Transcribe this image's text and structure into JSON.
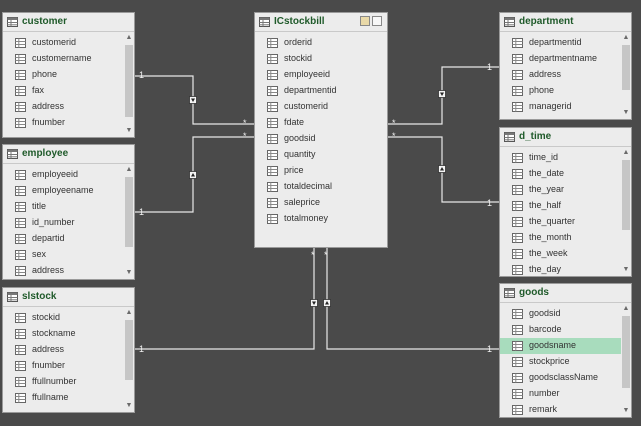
{
  "tables": [
    {
      "title": "customer",
      "fields": [
        "customerid",
        "customername",
        "phone",
        "fax",
        "address",
        "fnumber"
      ],
      "has_scroll": true
    },
    {
      "title": "employee",
      "fields": [
        "employeeid",
        "employeename",
        "title",
        "id_number",
        "departid",
        "sex",
        "address"
      ],
      "has_scroll": true
    },
    {
      "title": "slstock",
      "fields": [
        "stockid",
        "stockname",
        "address",
        "fnumber",
        "ffullnumber",
        "ffullname"
      ],
      "has_scroll": true
    },
    {
      "title": "ICstockbill",
      "fields": [
        "orderid",
        "stockid",
        "employeeid",
        "departmentid",
        "customerid",
        "fdate",
        "goodsid",
        "quantity",
        "price",
        "totaldecimal",
        "saleprice",
        "totalmoney"
      ],
      "has_scroll": false,
      "header_buttons": true
    },
    {
      "title": "department",
      "fields": [
        "departmentid",
        "departmentname",
        "address",
        "phone",
        "managerid"
      ],
      "has_scroll": true
    },
    {
      "title": "d_time",
      "fields": [
        "time_id",
        "the_date",
        "the_year",
        "the_half",
        "the_quarter",
        "the_month",
        "the_week",
        "the_day"
      ],
      "has_scroll": true
    },
    {
      "title": "goods",
      "fields": [
        "goodsid",
        "barcode",
        "goodsname",
        "stockprice",
        "goodsclassName",
        "number",
        "remark"
      ],
      "has_scroll": true,
      "selected_field": "goodsname"
    }
  ],
  "relationships": [
    {
      "one": "customer",
      "many": "ICstockbill",
      "one_label": "1",
      "many_label": "*"
    },
    {
      "one": "employee",
      "many": "ICstockbill",
      "one_label": "1",
      "many_label": "*"
    },
    {
      "one": "slstock",
      "many": "ICstockbill",
      "one_label": "1",
      "many_label": "*"
    },
    {
      "one": "department",
      "many": "ICstockbill",
      "one_label": "1",
      "many_label": "*"
    },
    {
      "one": "d_time",
      "many": "ICstockbill",
      "one_label": "1",
      "many_label": "*"
    },
    {
      "one": "goods",
      "many": "ICstockbill",
      "one_label": "1",
      "many_label": "*"
    }
  ],
  "icons": {
    "table": "table-icon",
    "field": "column-icon",
    "filter": "filter-direction-icon"
  },
  "colors": {
    "canvas": "#4a4a4a",
    "table_bg": "#ececec",
    "title": "#1f5a2a",
    "selected_row": "#a8dcbd",
    "line": "#e8e8e8"
  }
}
